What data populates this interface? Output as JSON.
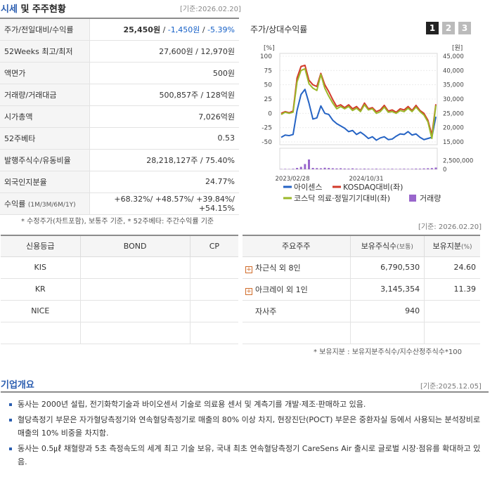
{
  "header": {
    "title_blue": "시세",
    "title_rest": " 및 주주현황",
    "base_date": "[기준:2026.02.20]"
  },
  "quote": {
    "rows": [
      {
        "label": "주가/전일대비/수익률",
        "price": "25,450원",
        "sep1": " / ",
        "change": "-1,450원",
        "sep2": " / ",
        "pct": "-5.39%"
      },
      {
        "label": "52Weeks 최고/최저",
        "value": "27,600원 / 12,970원"
      },
      {
        "label": "액면가",
        "value": "500원"
      },
      {
        "label": "거래량/거래대금",
        "value": "500,857주 / 128억원"
      },
      {
        "label": "시가총액",
        "value": "7,026억원"
      },
      {
        "label": "52주베타",
        "value": "0.53"
      },
      {
        "label": "발행주식수/유동비율",
        "value": "28,218,127주 / 75.40%"
      },
      {
        "label": "외국인지분율",
        "value": "24.77%"
      },
      {
        "label": "수익률",
        "label_small": "(1M/3M/6M/1Y)",
        "value": "+68.32%/ +48.57%/ +39.84%/ +54.15%"
      }
    ],
    "footnote": "* 수정주가(차트포함), 보통주 기준, * 52주베타: 주간수익률 기준"
  },
  "chart_panel": {
    "title": "주가/상대수익률",
    "tabs": [
      "1",
      "2",
      "3"
    ]
  },
  "chart_data": {
    "type": "line",
    "x_ticks": [
      "2023/02/28",
      "2024/10/31"
    ],
    "left_axis": {
      "unit": "[%]",
      "ticks": [
        100,
        75,
        50,
        25,
        0,
        -25,
        -50
      ],
      "range": [
        -50,
        100
      ]
    },
    "right_axis": {
      "unit": "[원]",
      "ticks": [
        45000,
        40000,
        35000,
        30000,
        25000,
        20000,
        15000
      ],
      "range": [
        15000,
        45000
      ]
    },
    "volume_axis": {
      "ticks": [
        2500000,
        0
      ],
      "tick_labels": [
        "2,500,000",
        "0"
      ],
      "range": [
        0,
        5000000
      ]
    },
    "series": [
      {
        "name": "아이센스",
        "color": "#2563c4",
        "values": [
          -42,
          -38,
          -39,
          -37,
          5,
          33,
          42,
          18,
          -10,
          -8,
          13,
          0,
          -2,
          -12,
          -18,
          -22,
          -26,
          -32,
          -30,
          -37,
          -33,
          -38,
          -44,
          -41,
          -47,
          -43,
          -41,
          -46,
          -45,
          -40,
          -36,
          -37,
          -32,
          -38,
          -36,
          -42,
          -46,
          -44,
          -42,
          -6
        ]
      },
      {
        "name": "KOSDAQ대비(좌)",
        "color": "#d23a2a",
        "values": [
          0,
          3,
          1,
          4,
          62,
          82,
          84,
          58,
          50,
          47,
          70,
          50,
          38,
          24,
          12,
          15,
          10,
          15,
          8,
          12,
          5,
          18,
          8,
          10,
          3,
          6,
          14,
          4,
          6,
          2,
          8,
          6,
          12,
          5,
          14,
          5,
          0,
          -12,
          -38,
          16
        ]
      },
      {
        "name": "코스닥 의료·정밀기기대비(좌)",
        "color": "#9bb82a",
        "values": [
          -2,
          2,
          0,
          2,
          55,
          75,
          78,
          52,
          44,
          40,
          68,
          44,
          30,
          18,
          8,
          12,
          8,
          12,
          5,
          9,
          3,
          15,
          6,
          8,
          0,
          3,
          11,
          2,
          3,
          0,
          5,
          3,
          9,
          3,
          11,
          3,
          -3,
          -15,
          -44,
          14
        ]
      },
      {
        "name": "거래량",
        "color": "#9966cc",
        "type": "bar",
        "values": [
          80000,
          120000,
          90000,
          160000,
          400000,
          700000,
          1500000,
          2800000,
          400000,
          350000,
          300000,
          450000,
          380000,
          300000,
          250000,
          300000,
          220000,
          200000,
          260000,
          180000,
          150000,
          200000,
          160000,
          140000,
          180000,
          120000,
          150000,
          130000,
          160000,
          110000,
          140000,
          170000,
          130000,
          150000,
          200000,
          180000,
          250000,
          300000,
          350000,
          500000
        ]
      }
    ]
  },
  "credit": {
    "headers": [
      "신용등급",
      "BOND",
      "CP"
    ],
    "rows": [
      [
        "KIS",
        "",
        ""
      ],
      [
        "KR",
        "",
        ""
      ],
      [
        "NICE",
        "",
        ""
      ],
      [
        "",
        "",
        ""
      ]
    ]
  },
  "holders": {
    "base_date": "[기준: 2026.02.20]",
    "headers": {
      "name": "주요주주",
      "shares": "보유주식수",
      "shares_unit": "(보통)",
      "pct": "보유지분",
      "pct_unit": "(%)"
    },
    "rows": [
      {
        "name": "차근식 외 8인",
        "expand": "+",
        "shares": "6,790,530",
        "pct": "24.60"
      },
      {
        "name": "아크레이 외 1인",
        "expand": "+",
        "shares": "3,145,354",
        "pct": "11.39"
      },
      {
        "name": "자사주",
        "shares": "940",
        "pct": ""
      },
      {
        "name": "",
        "shares": "",
        "pct": ""
      }
    ],
    "note": "* 보유지분 : 보유지분주식수/지수산정주식수*100"
  },
  "company": {
    "title": "기업개요",
    "base_date": "[기준:2025.12.05]",
    "items": [
      "동사는 2000년 설립, 전기화학기술과 바이오센서 기술로 의료용 센서 및 계측기를 개발·제조·판매하고 있음.",
      "혈당측정기 부문은 자가혈당측정기와 연속혈당측정기로 매출의 80% 이상 차지, 현장진단(POCT) 부문은 중환자실 등에서 사용되는 분석장비로 매출의 10% 비중을 차지함.",
      "동사는 0.5㎕ 채혈량과 5초 측정속도의 세계 최고 기술 보유, 국내 최초 연속혈당측정기 CareSens Air 출시로 글로벌 시장·점유를 확대하고 있음."
    ]
  }
}
